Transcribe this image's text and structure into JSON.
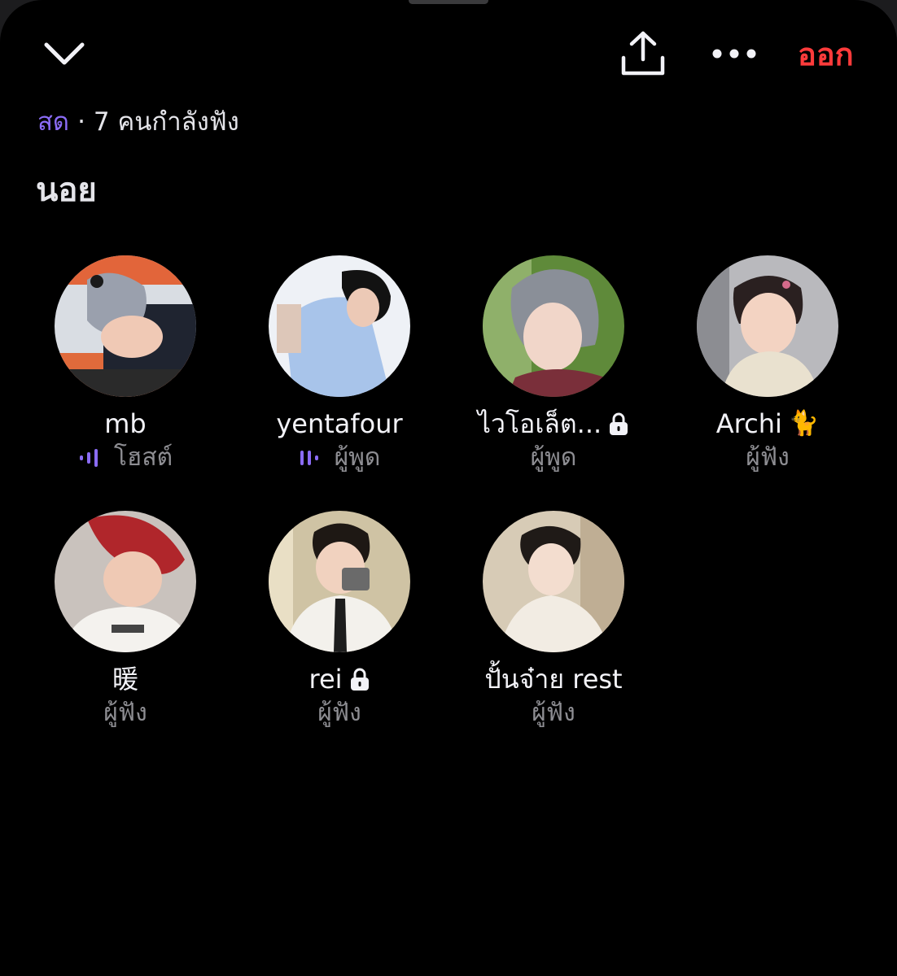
{
  "colors": {
    "background": "#000000",
    "accent_purple": "#8b6cf6",
    "leave_red": "#ff3b3b",
    "text_primary": "#f2f2f7",
    "text_secondary": "#8e8e93"
  },
  "header": {
    "collapse_icon": "chevron-down-icon",
    "share_icon": "share-icon",
    "more_icon": "more-icon",
    "leave_label": "ออก"
  },
  "status": {
    "live_label": "สด",
    "separator": "·",
    "listeners_text": "7 คนกำลังฟัง"
  },
  "room": {
    "title": "นอย"
  },
  "participants": [
    {
      "name": "mb",
      "role": "โฮสต์",
      "speaking": true,
      "locked": false,
      "emoji": ""
    },
    {
      "name": "yentafour",
      "role": "ผู้พูด",
      "speaking": true,
      "locked": false,
      "emoji": ""
    },
    {
      "name": "ไวโอเล็ต...",
      "role": "ผู้พูด",
      "speaking": false,
      "locked": true,
      "emoji": ""
    },
    {
      "name": "Archi",
      "role": "ผู้ฟัง",
      "speaking": false,
      "locked": false,
      "emoji": "🐈"
    },
    {
      "name": "暖",
      "role": "ผู้ฟัง",
      "speaking": false,
      "locked": false,
      "emoji": ""
    },
    {
      "name": "rei",
      "role": "ผู้ฟัง",
      "speaking": false,
      "locked": true,
      "emoji": ""
    },
    {
      "name": "ปั้นจ๋าย rest",
      "role": "ผู้ฟัง",
      "speaking": false,
      "locked": false,
      "emoji": ""
    }
  ]
}
